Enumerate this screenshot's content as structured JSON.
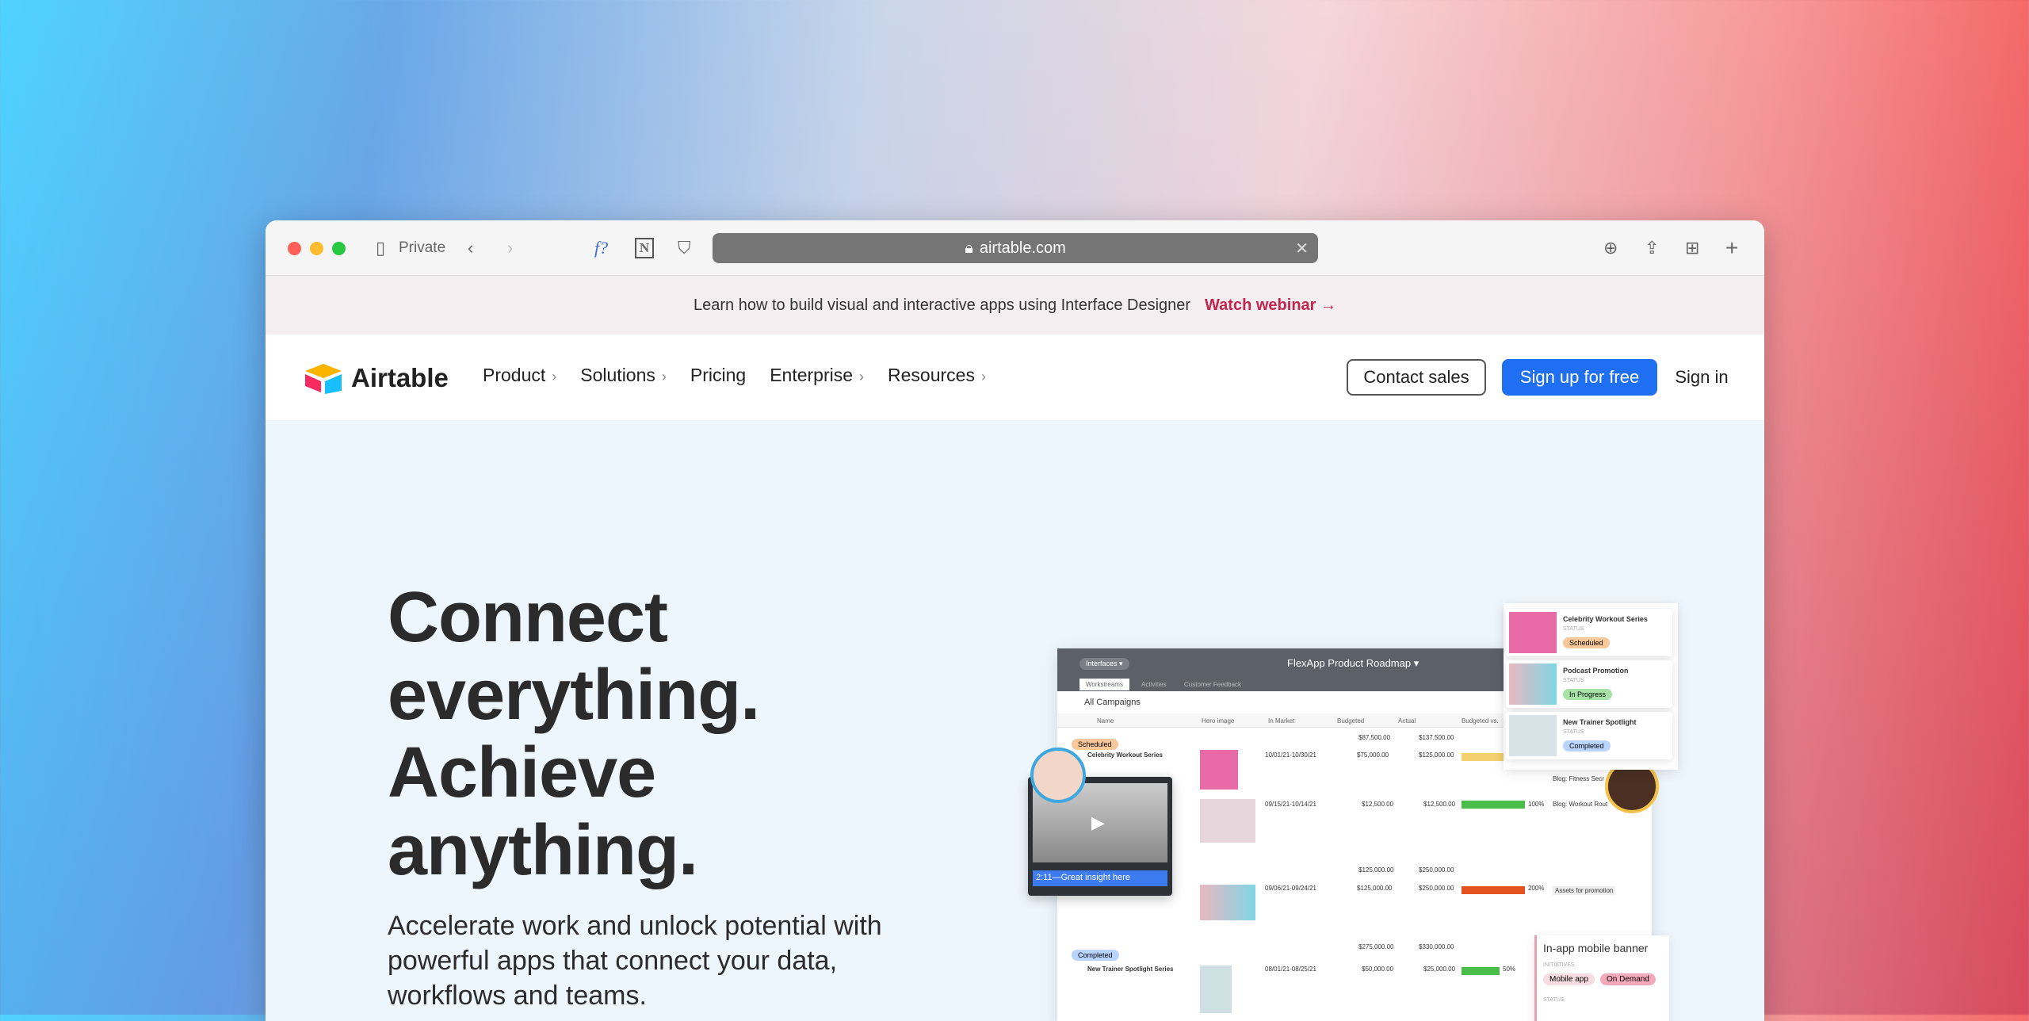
{
  "browser": {
    "private_label": "Private",
    "url": "airtable.com"
  },
  "banner": {
    "text": "Learn how to build visual and interactive apps using Interface Designer",
    "link": "Watch webinar →"
  },
  "nav": {
    "logo": "Airtable",
    "items": [
      {
        "label": "Product",
        "chevron": "›"
      },
      {
        "label": "Solutions",
        "chevron": "›"
      },
      {
        "label": "Pricing",
        "chevron": ""
      },
      {
        "label": "Enterprise",
        "chevron": "›"
      },
      {
        "label": "Resources",
        "chevron": "›"
      }
    ],
    "contact": "Contact sales",
    "signup": "Sign up for free",
    "signin": "Sign in"
  },
  "hero": {
    "lines": [
      "Connect",
      "everything.",
      "Achieve",
      "anything."
    ],
    "subtitle": "Accelerate work and unlock potential with powerful apps that connect your data, workflows and teams."
  },
  "app": {
    "interfaces": "Interfaces ▾",
    "title": "FlexApp Product Roadmap ▾",
    "tabs": [
      "Workstreams",
      "Activities",
      "Customer Feedback"
    ],
    "view": "All Campaigns",
    "columns": [
      "Name",
      "Hero image",
      "In Market",
      "Budgeted",
      "Actual",
      "Budgeted vs."
    ],
    "groups": [
      {
        "status": "Scheduled",
        "sum_budget": "$87,500.00",
        "sum_actual": "$137,500.00"
      },
      {
        "status": "",
        "sum_budget": "$125,000.00",
        "sum_actual": "$250,000.00"
      },
      {
        "status": "Completed",
        "sum_budget": "$275,000.00",
        "sum_actual": "$330,000.00"
      }
    ],
    "rows": [
      {
        "name": "Celebrity Workout Series",
        "dates": "10/01/21-10/30/21",
        "budget": "$75,000.00",
        "actual": "$125,000.00",
        "pct": "",
        "note": "Blog: Fitness Secr"
      },
      {
        "name": "",
        "dates": "09/15/21-10/14/21",
        "budget": "$12,500.00",
        "actual": "$12,500.00",
        "pct": "100%",
        "note": "Blog: Workout Rout"
      },
      {
        "name": "",
        "dates": "09/06/21-09/24/21",
        "budget": "$125,000.00",
        "actual": "$250,000.00",
        "pct": "200%",
        "note": "Assets for promotion"
      },
      {
        "name": "New Trainer Spotlight Series",
        "dates": "08/01/21-08/25/21",
        "budget": "$50,000.00",
        "actual": "$25,000.00",
        "pct": "50%",
        "note": ""
      }
    ],
    "video_caption": "2:11—Great insight here",
    "cards": [
      {
        "title": "Celebrity Workout Series",
        "label": "STATUS",
        "status": "Scheduled",
        "color": "#f8c79a"
      },
      {
        "title": "Podcast Promotion",
        "label": "STATUS",
        "status": "In Progress",
        "color": "#a7e3a7"
      },
      {
        "title": "New Trainer Spotlight",
        "label": "STATUS",
        "status": "Completed",
        "color": "#b9d4ff"
      }
    ],
    "banner_card": {
      "title": "In-app mobile banner",
      "label": "INITIATIVES",
      "tags": [
        "Mobile app",
        "On Demand"
      ],
      "status_label": "STATUS"
    }
  }
}
